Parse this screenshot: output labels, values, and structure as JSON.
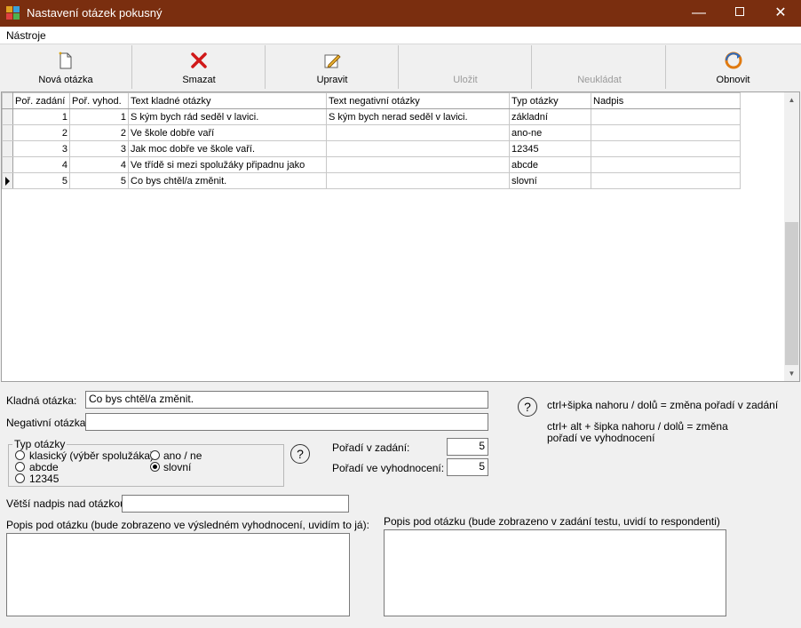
{
  "window": {
    "title": "Nastavení otázek pokusný",
    "minimize_glyph": "—",
    "close_glyph": "✕"
  },
  "menu": {
    "tools": "Nástroje"
  },
  "toolbar": {
    "new_question": "Nová otázka",
    "delete": "Smazat",
    "edit": "Upravit",
    "save": "Uložit",
    "dont_save": "Neukládat",
    "refresh": "Obnovit"
  },
  "grid": {
    "columns": [
      "Poř. zadání",
      "Poř. vyhod.",
      "Text kladné otázky",
      "Text negativní otázky",
      "Typ otázky",
      "Nadpis"
    ],
    "rows": [
      {
        "order_assign": "1",
        "order_eval": "1",
        "positive": "S kým bych rád seděl v lavici.",
        "negative": "S kým bych nerad seděl v lavici.",
        "type": "základní",
        "heading": ""
      },
      {
        "order_assign": "2",
        "order_eval": "2",
        "positive": "Ve škole dobře vaří",
        "negative": "",
        "type": "ano-ne",
        "heading": ""
      },
      {
        "order_assign": "3",
        "order_eval": "3",
        "positive": "Jak moc dobře ve škole vaří.",
        "negative": "",
        "type": "12345",
        "heading": ""
      },
      {
        "order_assign": "4",
        "order_eval": "4",
        "positive": "Ve třídě si mezi spolužáky připadnu jako",
        "negative": "",
        "type": "abcde",
        "heading": ""
      },
      {
        "order_assign": "5",
        "order_eval": "5",
        "positive": "Co bys chtěl/a změnit.",
        "negative": "",
        "type": "slovní",
        "heading": ""
      }
    ]
  },
  "form": {
    "positive_label": "Kladná otázka:",
    "positive_value": "Co bys chtěl/a změnit.",
    "negative_label": "Negativní otázka:",
    "negative_value": "",
    "type_group_label": "Typ otázky",
    "type_options": [
      "klasický (výběr spolužáka)",
      "abcde",
      "12345",
      "ano / ne",
      "slovní"
    ],
    "order_assign_label": "Pořadí v zadání:",
    "order_assign_value": "5",
    "order_eval_label": "Pořadí ve vyhodnocení:",
    "order_eval_value": "5",
    "heading_label": "Větší nadpis nad otázkou:",
    "heading_value": "",
    "desc_eval_label": "Popis pod otázku (bude zobrazeno ve výsledném vyhodnocení, uvidím to já):",
    "desc_assign_label": "Popis pod otázku (bude zobrazeno v zadání testu, uvidí to respondenti)",
    "help_glyph": "?"
  },
  "help": {
    "line1": "ctrl+šipka nahoru / dolů = změna pořadí v zadání",
    "line2a": "ctrl+ alt + šipka nahoru / dolů = změna",
    "line2b": "pořadí ve vyhodnocení"
  },
  "colors": {
    "titlebar": "#7a2e0f"
  }
}
